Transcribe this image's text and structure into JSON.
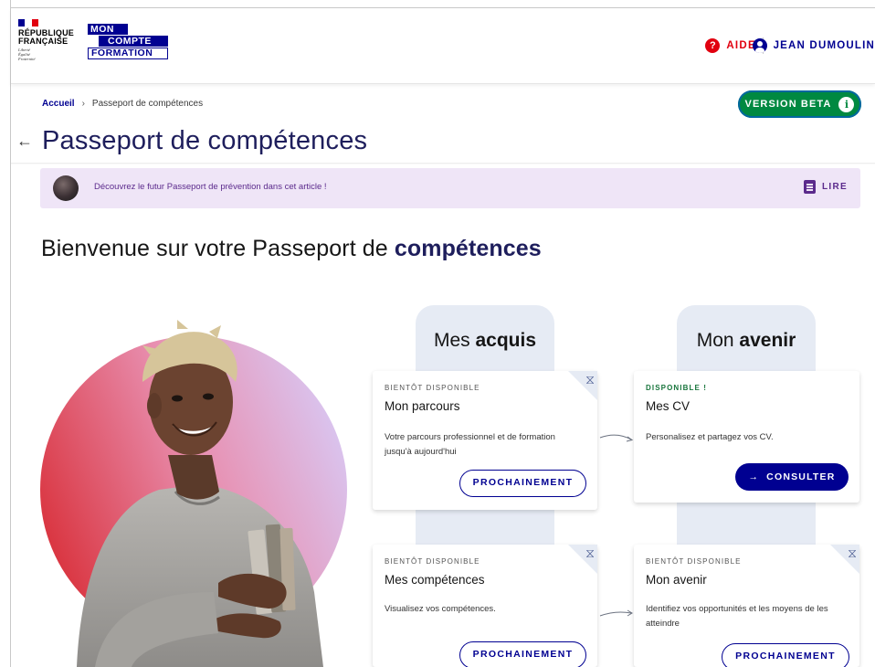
{
  "header": {
    "gov_logo_lines": [
      "RÉPUBLIQUE",
      "FRANÇAISE"
    ],
    "gov_motto": [
      "Liberté",
      "Égalité",
      "Fraternité"
    ],
    "app_logo": {
      "line1": "MON",
      "line2": "COMPTE",
      "line3": "FORMATION"
    },
    "help_label": "AIDE",
    "user_name": "JEAN DUMOULIN"
  },
  "breadcrumb": {
    "home": "Accueil",
    "current": "Passeport de compétences"
  },
  "beta_badge": "VERSION BETA",
  "page_title": "Passeport de compétences",
  "banner": {
    "text": "Découvrez le futur Passeport de prévention dans cet article !",
    "link_label": "LIRE"
  },
  "welcome": {
    "prefix": "Bienvenue sur votre Passeport de ",
    "emphasis": "compétences"
  },
  "columns": [
    {
      "prefix": "Mes ",
      "emphasis": "acquis"
    },
    {
      "prefix": "Mon ",
      "emphasis": "avenir"
    }
  ],
  "cards": [
    {
      "status": "BIENTÔT DISPONIBLE",
      "title": "Mon parcours",
      "desc": "Votre parcours professionnel et de formation jusqu'à aujourd'hui",
      "button": "PROCHAINEMENT"
    },
    {
      "status": "DISPONIBLE !",
      "title": "Mes CV",
      "desc": "Personalisez et partagez vos CV.",
      "button": "CONSULTER"
    },
    {
      "status": "BIENTÔT DISPONIBLE",
      "title": "Mes compétences",
      "desc": "Visualisez vos compétences.",
      "button": "PROCHAINEMENT"
    },
    {
      "status": "BIENTÔT DISPONIBLE",
      "title": "Mon avenir",
      "desc": "Identifiez vos opportunités et les moyens de les atteindre",
      "button": "PROCHAINEMENT"
    }
  ],
  "colors": {
    "primary": "#000091",
    "accent_red": "#e1000f",
    "beta_green": "#008941",
    "banner_purple": "#5b2a8c",
    "available_green": "#18753c"
  }
}
